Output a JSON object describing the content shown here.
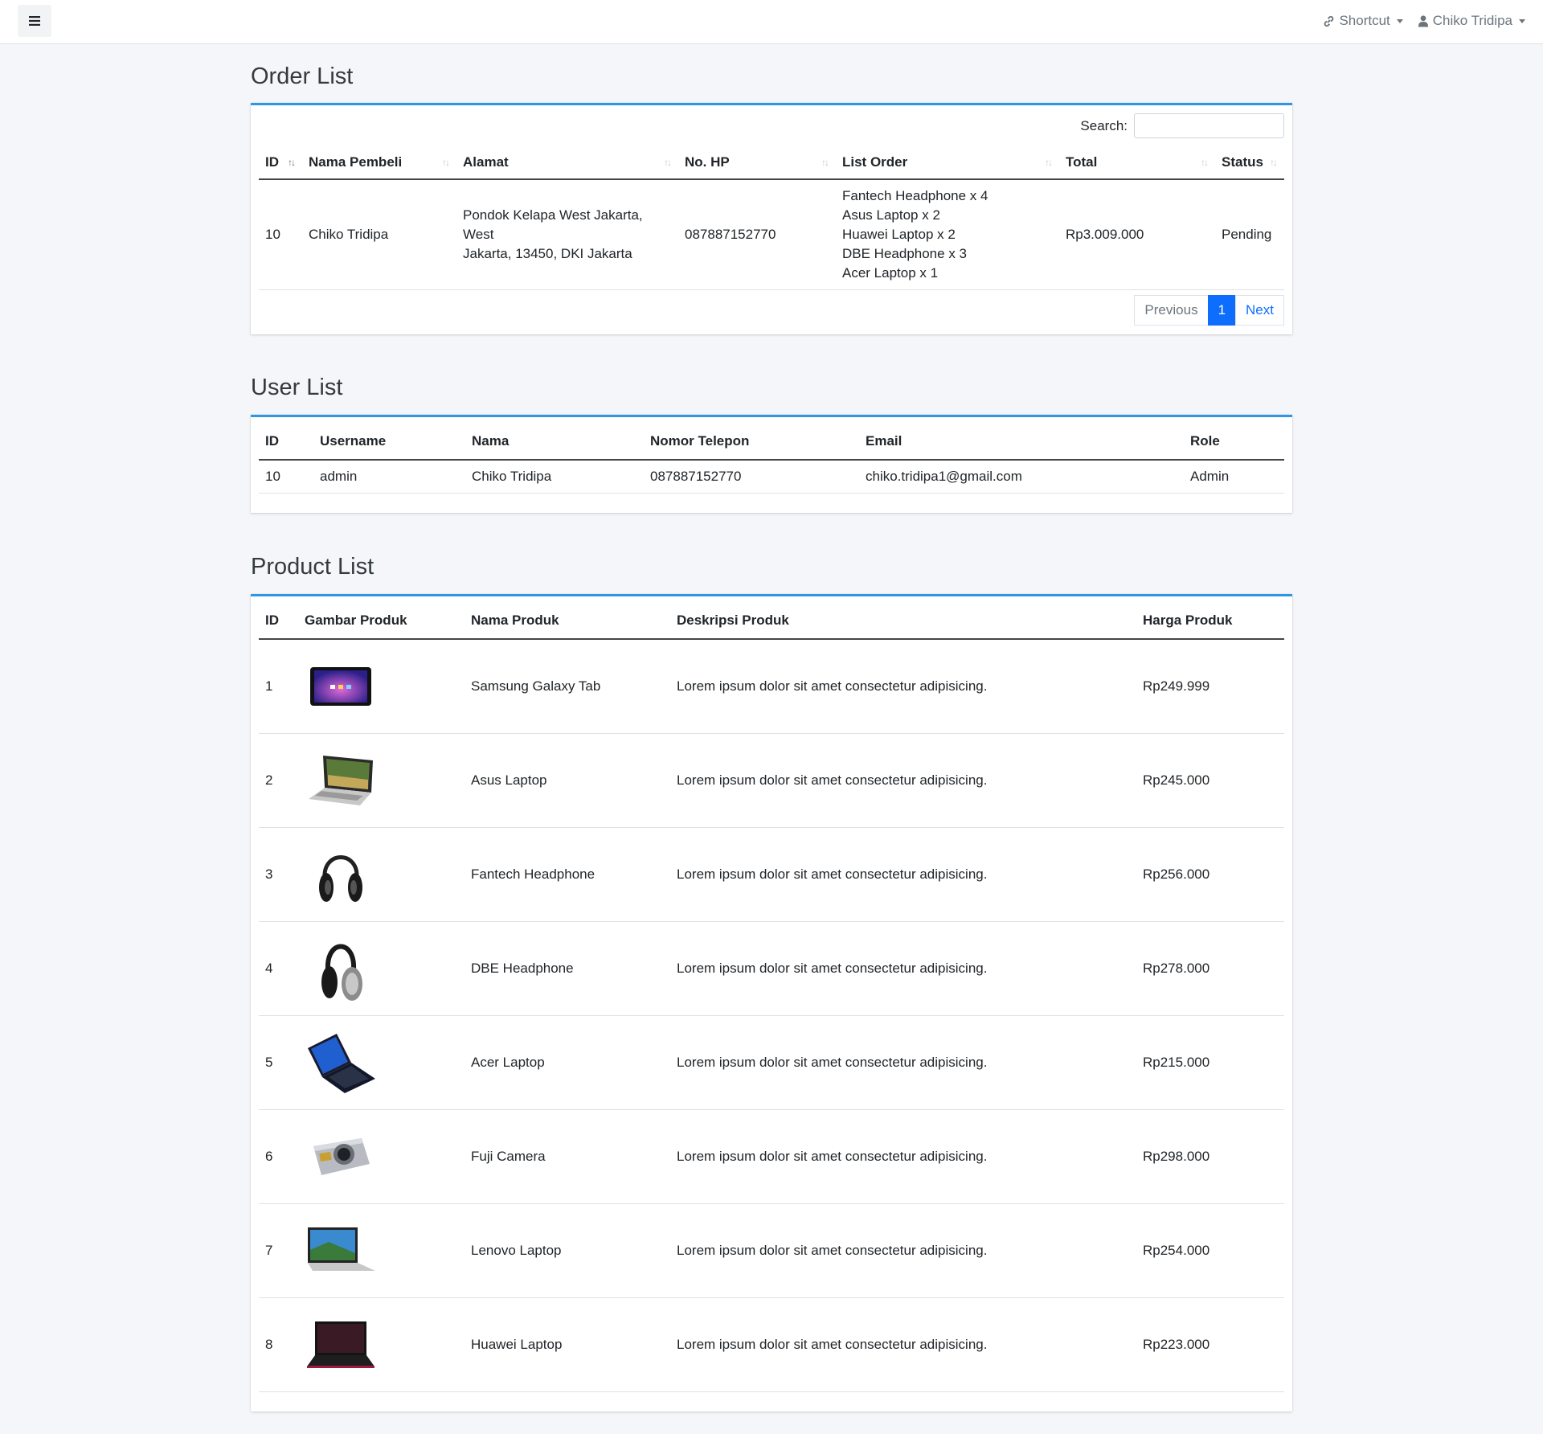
{
  "nav": {
    "shortcut_label": "Shortcut",
    "user_label": "Chiko Tridipa"
  },
  "orders": {
    "title": "Order List",
    "search_label": "Search:",
    "headers": [
      "ID",
      "Nama Pembeli",
      "Alamat",
      "No. HP",
      "List Order",
      "Total",
      "Status"
    ],
    "rows": [
      {
        "id": "10",
        "buyer": "Chiko Tridipa",
        "address_line1": "Pondok Kelapa West Jakarta, West",
        "address_line2": "Jakarta, 13450, DKI Jakarta",
        "phone": "087887152770",
        "items": [
          "Fantech Headphone x 4",
          "Asus Laptop x 2",
          "Huawei Laptop x 2",
          "DBE Headphone x 3",
          "Acer Laptop x 1"
        ],
        "total": "Rp3.009.000",
        "status": "Pending"
      }
    ],
    "pager": {
      "previous": "Previous",
      "current": "1",
      "next": "Next"
    }
  },
  "users": {
    "title": "User List",
    "headers": [
      "ID",
      "Username",
      "Nama",
      "Nomor Telepon",
      "Email",
      "Role"
    ],
    "rows": [
      {
        "id": "10",
        "username": "admin",
        "name": "Chiko Tridipa",
        "phone": "087887152770",
        "email": "chiko.tridipa1@gmail.com",
        "role": "Admin"
      }
    ]
  },
  "products": {
    "title": "Product List",
    "headers": [
      "ID",
      "Gambar Produk",
      "Nama Produk",
      "Deskripsi Produk",
      "Harga Produk"
    ],
    "rows": [
      {
        "id": "1",
        "image": "tablet",
        "name": "Samsung Galaxy Tab",
        "desc": "Lorem ipsum dolor sit amet consectetur adipisicing.",
        "price": "Rp249.999"
      },
      {
        "id": "2",
        "image": "laptop-silver",
        "name": "Asus Laptop",
        "desc": "Lorem ipsum dolor sit amet consectetur adipisicing.",
        "price": "Rp245.000"
      },
      {
        "id": "3",
        "image": "headphone-black",
        "name": "Fantech Headphone",
        "desc": "Lorem ipsum dolor sit amet consectetur adipisicing.",
        "price": "Rp256.000"
      },
      {
        "id": "4",
        "image": "headphone-silver",
        "name": "DBE Headphone",
        "desc": "Lorem ipsum dolor sit amet consectetur adipisicing.",
        "price": "Rp278.000"
      },
      {
        "id": "5",
        "image": "laptop-blue",
        "name": "Acer Laptop",
        "desc": "Lorem ipsum dolor sit amet consectetur adipisicing.",
        "price": "Rp215.000"
      },
      {
        "id": "6",
        "image": "camera",
        "name": "Fuji Camera",
        "desc": "Lorem ipsum dolor sit amet consectetur adipisicing.",
        "price": "Rp298.000"
      },
      {
        "id": "7",
        "image": "laptop-landscape",
        "name": "Lenovo Laptop",
        "desc": "Lorem ipsum dolor sit amet consectetur adipisicing.",
        "price": "Rp254.000"
      },
      {
        "id": "8",
        "image": "laptop-dark",
        "name": "Huawei Laptop",
        "desc": "Lorem ipsum dolor sit amet consectetur adipisicing.",
        "price": "Rp223.000"
      }
    ]
  },
  "colors": {
    "accent": "#2f96e6",
    "primary": "#0d6efd",
    "background": "#f4f6f9"
  }
}
